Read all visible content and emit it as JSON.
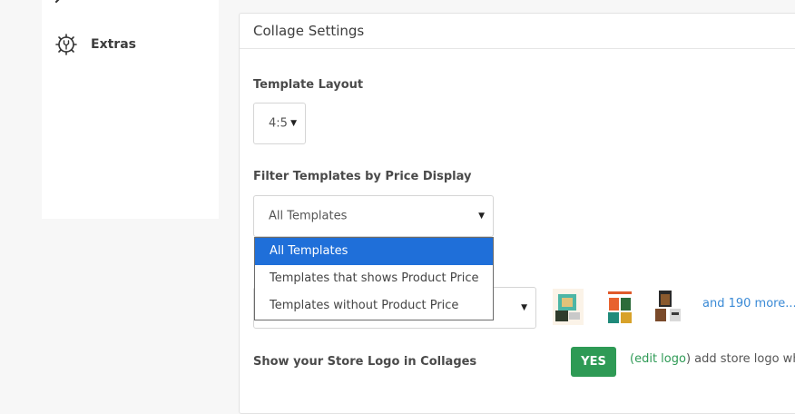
{
  "sidebar": {
    "top_icon": "wrench-icon",
    "extras": {
      "label": "Extras",
      "icon": "gear-settings-icon"
    }
  },
  "panel": {
    "title": "Collage Settings"
  },
  "template_layout": {
    "label": "Template Layout",
    "value": "4:5"
  },
  "price_filter": {
    "label": "Filter Templates by Price Display",
    "value": "All Templates",
    "options": [
      "All Templates",
      "Templates that shows Product Price",
      "Templates without Product Price"
    ],
    "selected_index": 0
  },
  "templates": {
    "more_link": "and 190 more..."
  },
  "store_logo": {
    "label": "Show your Store Logo in Collages",
    "toggle": "YES",
    "open_paren": "(",
    "edit_link": "edit logo",
    "close_paren": ")",
    "hint": " add store logo wh"
  },
  "colors": {
    "accent_green": "#2e9a55",
    "selection_blue": "#1f6fd9",
    "link_blue": "#3a8ad6"
  }
}
